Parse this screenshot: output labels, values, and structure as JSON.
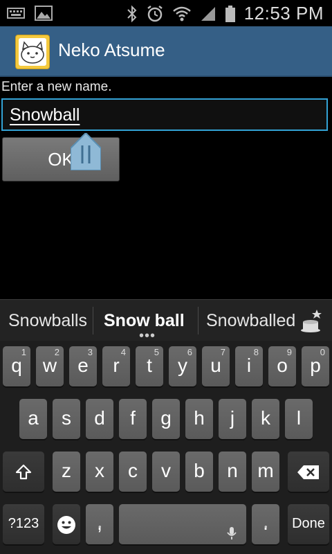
{
  "status_bar": {
    "time": "12:53 PM",
    "icons": [
      "keyboard-icon",
      "image-icon",
      "bluetooth-icon",
      "alarm-icon",
      "wifi-icon",
      "signal-icon",
      "battery-icon"
    ]
  },
  "app_bar": {
    "title": "Neko Atsume"
  },
  "dialog": {
    "prompt": "Enter a new name.",
    "name_value": "Snowball",
    "ok_label": "OK"
  },
  "suggestions": {
    "left": "Snowballs",
    "center": "Snow ball",
    "right": "Snowballed"
  },
  "keyboard": {
    "row1": [
      {
        "k": "q",
        "n": "1"
      },
      {
        "k": "w",
        "n": "2"
      },
      {
        "k": "e",
        "n": "3"
      },
      {
        "k": "r",
        "n": "4"
      },
      {
        "k": "t",
        "n": "5"
      },
      {
        "k": "y",
        "n": "6"
      },
      {
        "k": "u",
        "n": "7"
      },
      {
        "k": "i",
        "n": "8"
      },
      {
        "k": "o",
        "n": "9"
      },
      {
        "k": "p",
        "n": "0"
      }
    ],
    "row2": [
      "a",
      "s",
      "d",
      "f",
      "g",
      "h",
      "j",
      "k",
      "l"
    ],
    "row3": [
      "z",
      "x",
      "c",
      "v",
      "b",
      "n",
      "m"
    ],
    "symbols_label": "?123",
    "comma_label": ",",
    "period_label": ".",
    "done_label": "Done"
  },
  "colors": {
    "app_bar": "#355f86",
    "input_border": "#33a3d6",
    "key": "#606060"
  }
}
